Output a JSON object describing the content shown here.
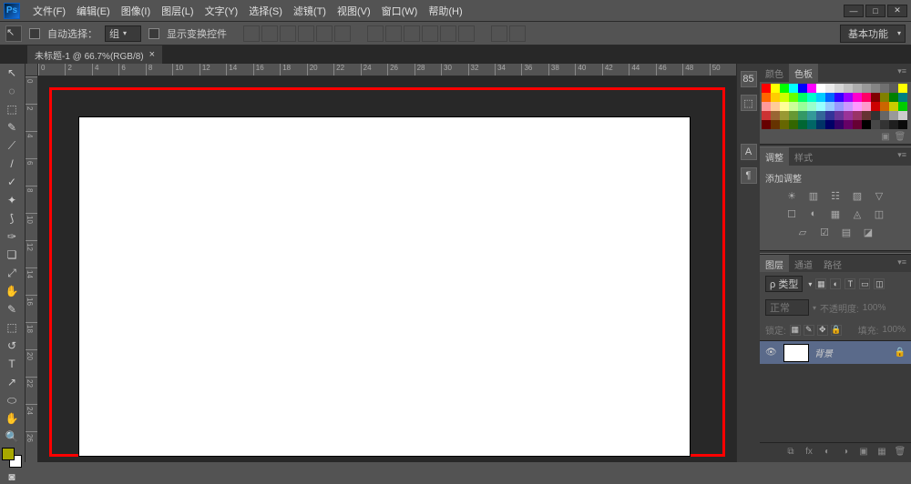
{
  "app": {
    "logo": "Ps"
  },
  "menu": [
    "文件(F)",
    "编辑(E)",
    "图像(I)",
    "图层(L)",
    "文字(Y)",
    "选择(S)",
    "滤镜(T)",
    "视图(V)",
    "窗口(W)",
    "帮助(H)"
  ],
  "win_controls": {
    "min": "—",
    "max": "□",
    "close": "✕"
  },
  "options": {
    "auto_select": "自动选择：",
    "auto_select_value": "组",
    "show_transform": "显示变换控件"
  },
  "workspace_label": "基本功能",
  "document_tab": "未标题-1 @ 66.7%(RGB/8)",
  "ruler_h": [
    "0",
    "2",
    "4",
    "6",
    "8",
    "10",
    "12",
    "14",
    "16",
    "18",
    "20",
    "22",
    "24",
    "26",
    "28",
    "30",
    "32",
    "34",
    "36",
    "38",
    "40",
    "42",
    "44",
    "46",
    "48",
    "50"
  ],
  "ruler_v": [
    "0",
    "2",
    "4",
    "6",
    "8",
    "10",
    "12",
    "14",
    "16",
    "18",
    "20",
    "22",
    "24",
    "26"
  ],
  "tools": [
    "↖",
    "◌",
    "⬚",
    "✎",
    "⟋",
    "/",
    "✓",
    "✦",
    "⟆",
    "✑",
    "❏",
    "⤢",
    "✋",
    "✎",
    "⬚",
    "↺",
    "T",
    "↗",
    "⬭",
    "✋",
    "🔍"
  ],
  "strip_icons": [
    "85",
    "⬚",
    "A",
    "¶"
  ],
  "panels": {
    "color_tab": "颜色",
    "swatches_tab": "色板",
    "adjustments_tab": "调整",
    "styles_tab": "样式",
    "add_adjustment": "添加调整",
    "adj_icons_1": [
      "☀",
      "▥",
      "☷",
      "▨",
      "▽"
    ],
    "adj_icons_2": [
      "☐",
      "◐",
      "▦",
      "◬",
      "◫"
    ],
    "adj_icons_3": [
      "▱",
      "☑",
      "▤",
      "◪"
    ],
    "layers_tab": "图层",
    "channels_tab": "通道",
    "paths_tab": "路径",
    "kind_label": "ρ 类型",
    "blend_mode": "正常",
    "opacity_label": "不透明度:",
    "opacity_value": "100%",
    "lock_label": "锁定:",
    "fill_label": "填充:",
    "fill_value": "100%",
    "layer_name": "背景",
    "swatch_colors": [
      "#ff0000",
      "#ffff00",
      "#00ff00",
      "#00ffff",
      "#0000ff",
      "#ff00ff",
      "#ffffff",
      "#ebebeb",
      "#d6d6d6",
      "#c2c2c2",
      "#adadad",
      "#999999",
      "#858585",
      "#707070",
      "#5c5c5c",
      "#ffff00",
      "#ff6600",
      "#ffcc00",
      "#ccff00",
      "#66ff00",
      "#00ff66",
      "#00ffcc",
      "#00ccff",
      "#0066ff",
      "#3300ff",
      "#9900ff",
      "#ff00cc",
      "#ff0066",
      "#800000",
      "#808000",
      "#008000",
      "#008080",
      "#ff9999",
      "#ffcc99",
      "#ffff99",
      "#ccff99",
      "#99ff99",
      "#99ffcc",
      "#99ffff",
      "#99ccff",
      "#9999ff",
      "#cc99ff",
      "#ff99ff",
      "#ff99cc",
      "#cc0000",
      "#cc6600",
      "#cccc00",
      "#00cc00",
      "#cc3333",
      "#996633",
      "#999933",
      "#669933",
      "#339966",
      "#339999",
      "#336699",
      "#333399",
      "#663399",
      "#993399",
      "#993366",
      "#663333",
      "#333333",
      "#666666",
      "#999999",
      "#cccccc",
      "#660000",
      "#663300",
      "#666600",
      "#336600",
      "#006633",
      "#006666",
      "#003366",
      "#000066",
      "#330066",
      "#660066",
      "#660033",
      "#000000",
      "#474747",
      "#333333",
      "#1f1f1f",
      "#0a0a0a"
    ]
  }
}
